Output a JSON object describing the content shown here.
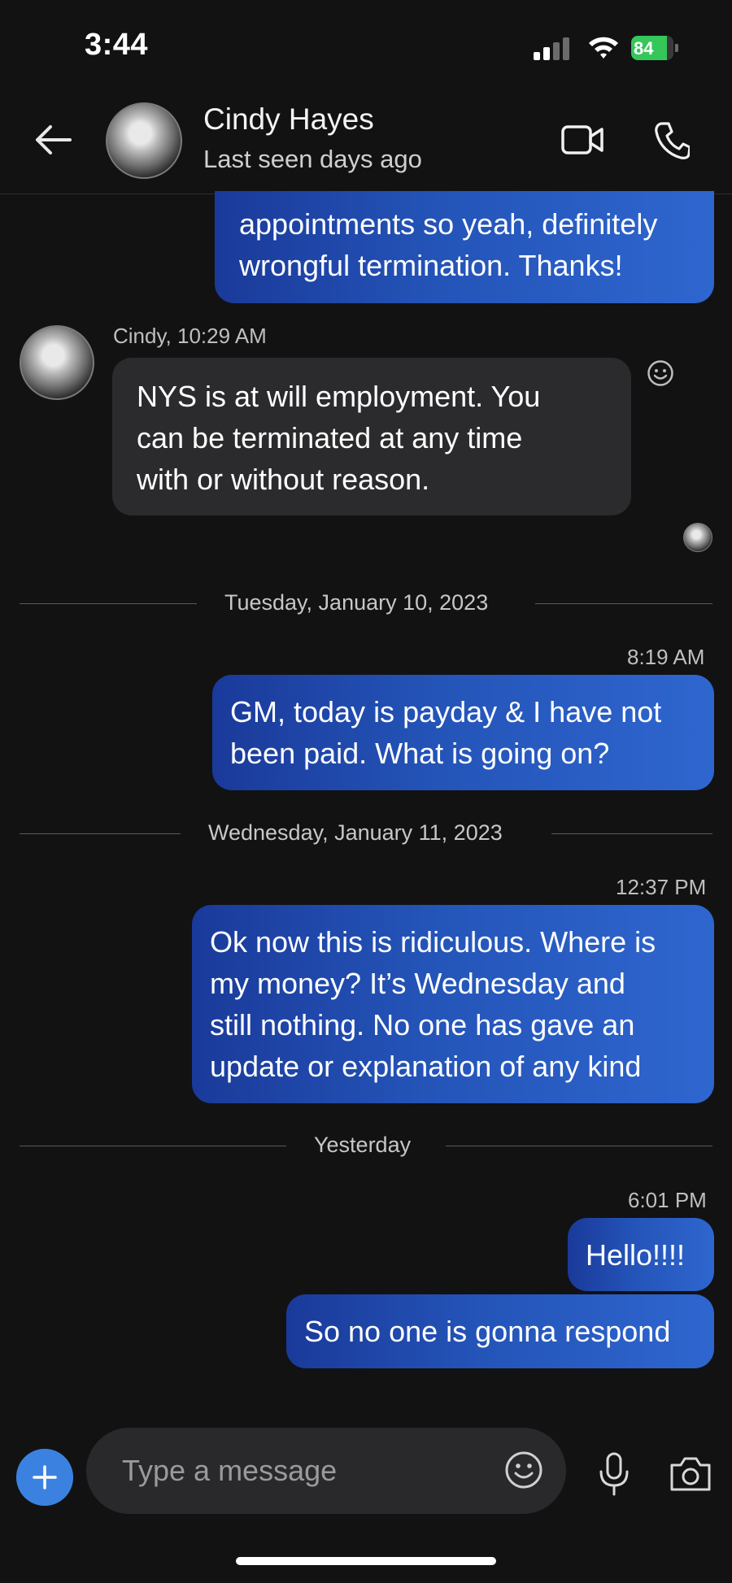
{
  "status_bar": {
    "time": "3:44",
    "battery_percent": 84,
    "battery_label": "84"
  },
  "header": {
    "contact_name": "Cindy Hayes",
    "contact_status": "Last seen days ago",
    "icons": [
      "back-arrow-icon",
      "contact-avatar",
      "video-call-icon",
      "phone-call-icon"
    ]
  },
  "messages": {
    "partial_outgoing": [
      "appointments so yeah, definitely",
      "wrongful termination. Thanks!"
    ],
    "incoming_meta": "Cindy, 10:29 AM",
    "incoming_lines": [
      "NYS is at will employment. You",
      "can be terminated at any time",
      "with or without reason."
    ],
    "date1": "Tuesday, January 10, 2023",
    "time1": "8:19 AM",
    "msg1_lines": [
      "GM, today is payday & I have not",
      "been paid. What is going on?"
    ],
    "date2": "Wednesday, January 11, 2023",
    "time2": "12:37 PM",
    "msg2_lines": [
      "Ok now this is ridiculous. Where is",
      "my money? It’s Wednesday and",
      "still nothing. No one has gave an",
      "update or explanation of any kind"
    ],
    "date3": "Yesterday",
    "time3": "6:01 PM",
    "msg3": "Hello!!!!",
    "msg4": "So no one is gonna respond"
  },
  "composer": {
    "placeholder": "Type a message"
  },
  "colors": {
    "background": "#121213",
    "outgoing_bubble_start": "#1a3a9a",
    "outgoing_bubble_end": "#2e66cf",
    "incoming_bubble": "#2b2b2d",
    "accent": "#3b82e0",
    "battery_green": "#34c759"
  }
}
